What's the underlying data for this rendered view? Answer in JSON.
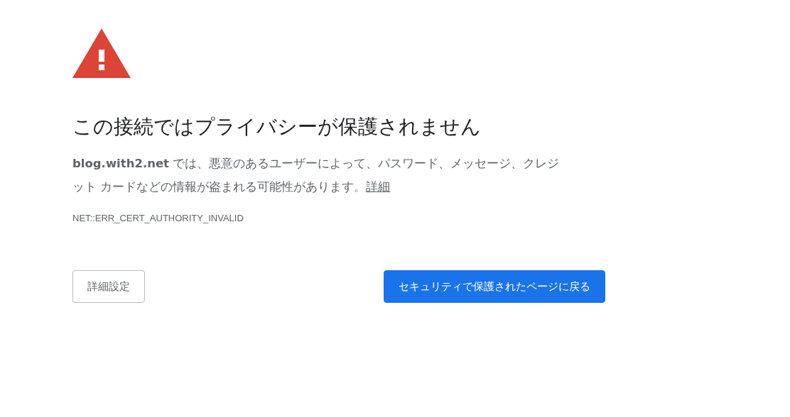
{
  "heading": "この接続ではプライバシーが保護されません",
  "message": {
    "text": "**blog.with2.net** では、悪意のあるユーザーによって、パスワード、メッセージ、クレジット カードなどの情報が盗まれる可能性があります。",
    "link": "詳細"
  },
  "error_code": "NET::ERR_CERT_AUTHORITY_INVALID",
  "buttons": [
    {
      "label": "詳細設定",
      "kind": "secondary"
    },
    {
      "label": "セキュリティで保護されたページに戻る",
      "kind": "primary"
    }
  ]
}
